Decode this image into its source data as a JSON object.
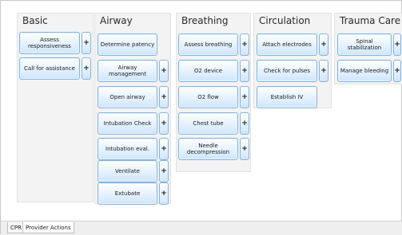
{
  "columns": [
    {
      "title": "Basic",
      "items": [
        {
          "label": "Assess responsiveness",
          "has_plus": true
        },
        {
          "label": "Call for assistance",
          "has_plus": true
        }
      ]
    },
    {
      "title": "Airway",
      "items": [
        {
          "label": "Determine patency",
          "has_plus": false
        },
        {
          "label": "Airway management",
          "has_plus": true
        },
        {
          "label": "Open airway",
          "has_plus": true
        },
        {
          "label": "Intubation Check",
          "has_plus": true
        },
        {
          "label": "Intubation eval.",
          "has_plus": true
        },
        {
          "label": "Ventilate",
          "has_plus": true
        },
        {
          "label": "Extubate",
          "has_plus": true
        }
      ]
    },
    {
      "title": "Breathing",
      "items": [
        {
          "label": "Assess breathing",
          "has_plus": true
        },
        {
          "label": "O2 device",
          "has_plus": true
        },
        {
          "label": "O2 flow",
          "has_plus": true
        },
        {
          "label": "Chest tube",
          "has_plus": true
        },
        {
          "label": "Needle decompression",
          "has_plus": true
        }
      ]
    },
    {
      "title": "Circulation",
      "items": [
        {
          "label": "Attach electrodes",
          "has_plus": true
        },
        {
          "label": "Check for pulses",
          "has_plus": true
        },
        {
          "label": "Establish IV",
          "has_plus": false
        }
      ]
    },
    {
      "title": "Trauma Care",
      "items": [
        {
          "label": "Spinal stabilization",
          "has_plus": true
        },
        {
          "label": "Manage bleeding",
          "has_plus": true
        }
      ]
    }
  ],
  "plus_label": "+",
  "tabs": [
    {
      "label": "CPR",
      "active": false
    },
    {
      "label": "Provider Actions",
      "active": true
    }
  ]
}
